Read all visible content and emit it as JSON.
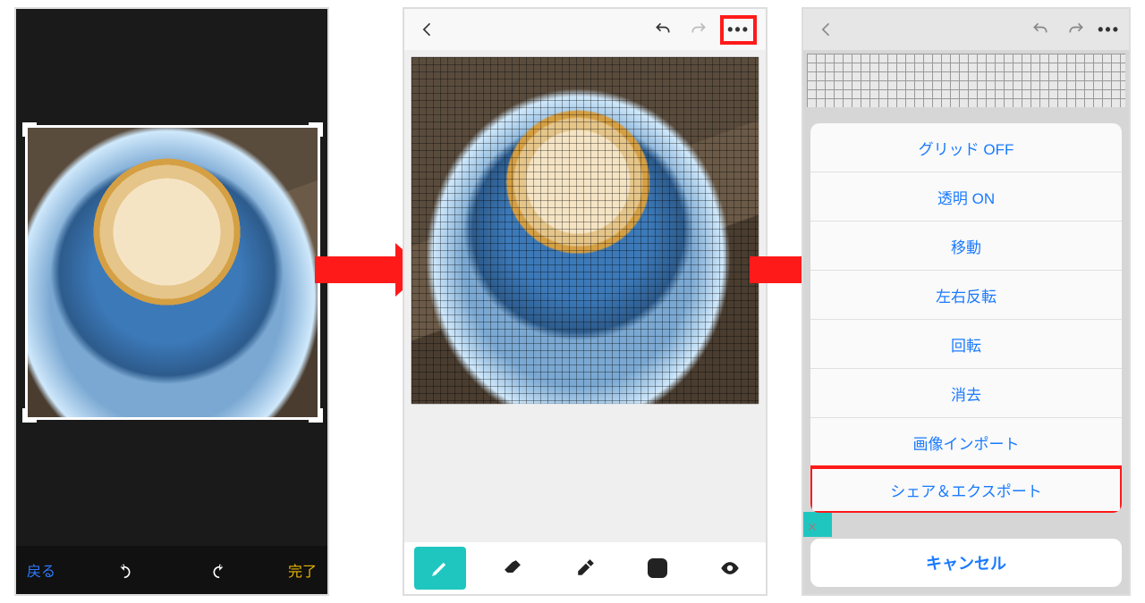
{
  "panel1": {
    "back_label": "戻る",
    "done_label": "完了",
    "rotate_left_icon": "rotate-left-icon",
    "rotate_right_icon": "rotate-right-icon",
    "image_description": "latte-art-blue-cup"
  },
  "panel2": {
    "back_icon": "back-arrow-icon",
    "undo_icon": "undo-icon",
    "redo_icon": "redo-icon",
    "more_icon": "more-icon",
    "tools": {
      "pencil": "pencil-icon",
      "eraser": "eraser-icon",
      "eyedropper": "eyedropper-icon",
      "color": "color-chip",
      "preview": "eye-icon"
    }
  },
  "panel3": {
    "back_icon": "back-arrow-icon",
    "undo_icon": "undo-icon",
    "redo_icon": "redo-icon",
    "more_icon": "more-icon",
    "menu": [
      "グリッド OFF",
      "透明 ON",
      "移動",
      "左右反転",
      "回転",
      "消去",
      "画像インポート",
      "シェア＆エクスポート"
    ],
    "highlighted_index": 7,
    "cancel_label": "キャンセル"
  }
}
